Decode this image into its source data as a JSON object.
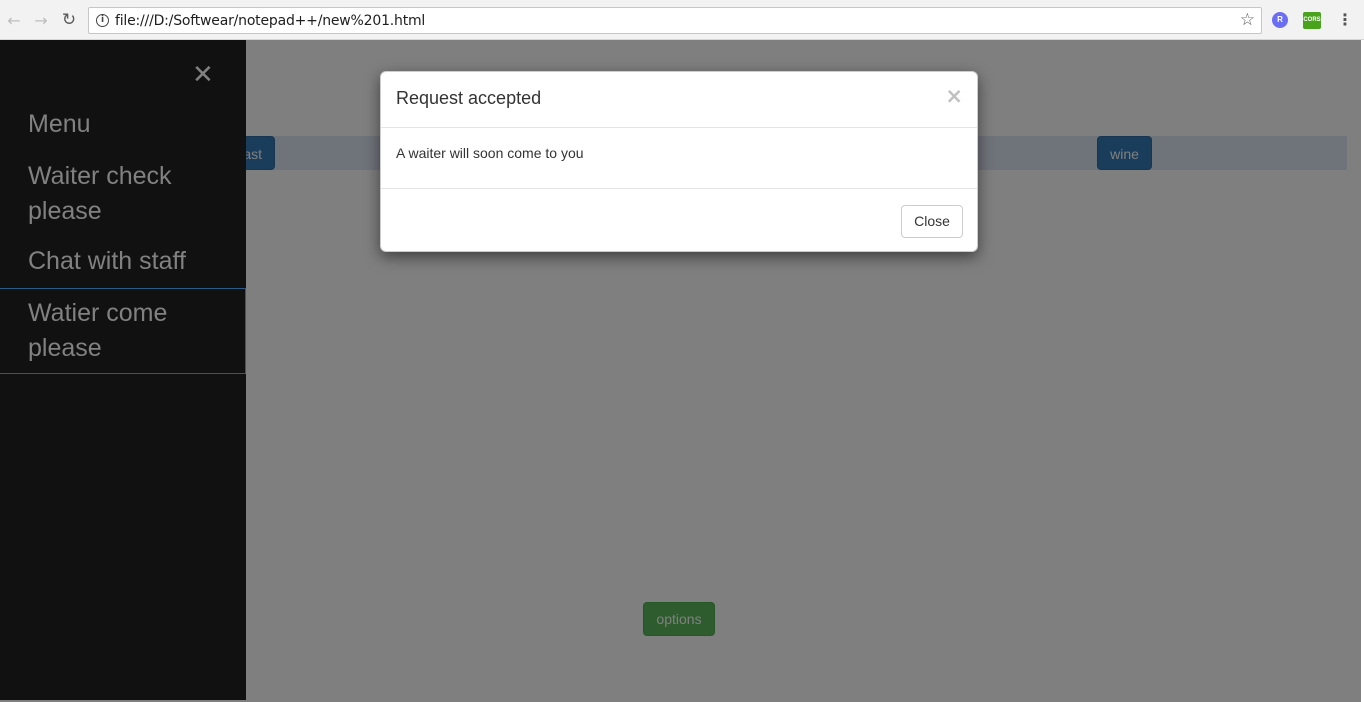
{
  "browser": {
    "back_glyph": "←",
    "forward_glyph": "→",
    "reload_glyph": "↻",
    "url": "file:///D:/Softwear/notepad++/new%201.html",
    "info_glyph": "i",
    "star_glyph": "☆",
    "ext_r_label": "R",
    "ext_cors_label": "CORS",
    "menu_glyph": "⋮"
  },
  "page": {
    "breakfast_button": "ast",
    "wine_button": "wine",
    "options_button": "options"
  },
  "sidenav": {
    "close_glyph": "✕",
    "items": [
      {
        "label": "Menu"
      },
      {
        "label": "Waiter check please"
      },
      {
        "label": "Chat with staff"
      },
      {
        "label": "Watier come please"
      }
    ]
  },
  "modal": {
    "title": "Request accepted",
    "close_glyph": "×",
    "body": "A waiter will soon come to you",
    "close_button": "Close"
  },
  "colors": {
    "sidenav_bg": "#111111",
    "primary": "#337ab7",
    "success": "#5cb85c",
    "sidenav_text": "#818181"
  }
}
